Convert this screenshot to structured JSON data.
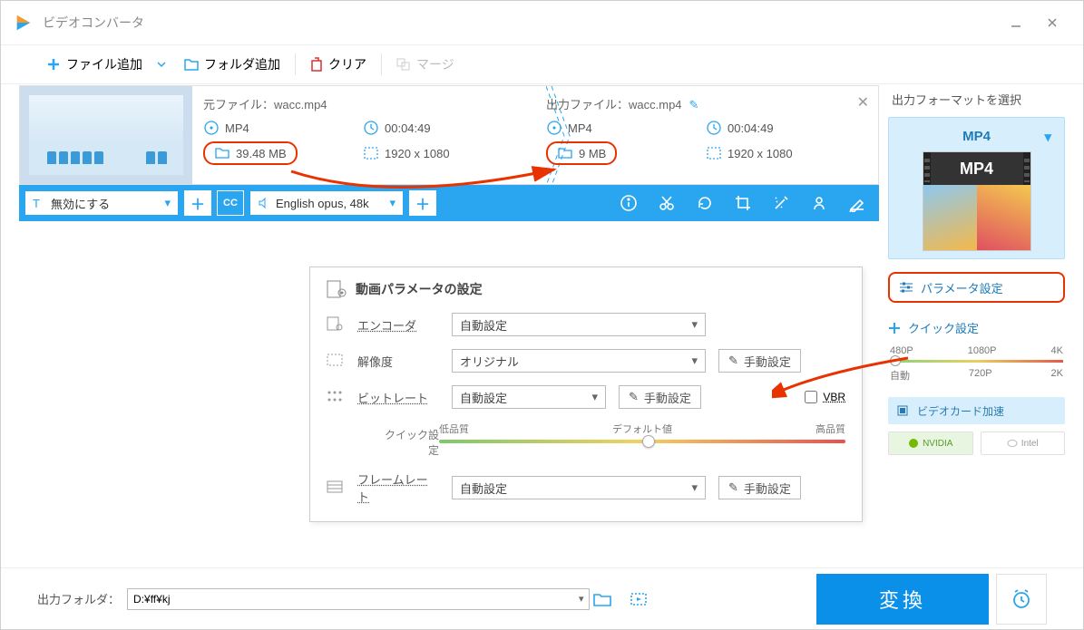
{
  "title": "ビデオコンバータ",
  "toolbar": {
    "add_file": "ファイル追加",
    "add_folder": "フォルダ追加",
    "clear": "クリア",
    "merge": "マージ"
  },
  "file": {
    "source": {
      "label": "元ファイル：",
      "name": "wacc.mp4",
      "format": "MP4",
      "duration": "00:04:49",
      "size": "39.48 MB",
      "resolution": "1920 x 1080"
    },
    "output": {
      "label": "出力ファイル：",
      "name": "wacc.mp4",
      "format": "MP4",
      "duration": "00:04:49",
      "size": "9 MB",
      "resolution": "1920 x 1080"
    }
  },
  "optbar": {
    "subtitle_mode": "無効にする",
    "audio_track": "English opus, 48k"
  },
  "params": {
    "panel_title": "動画パラメータの設定",
    "encoder_label": "エンコーダ",
    "encoder_value": "自動設定",
    "resolution_label": "解像度",
    "resolution_value": "オリジナル",
    "bitrate_label": "ビットレート",
    "bitrate_value": "自動設定",
    "vbr_label": "VBR",
    "quick_label": "クイック設定",
    "quality_low": "低品質",
    "quality_default": "デフォルト値",
    "quality_high": "高品質",
    "framerate_label": "フレームレート",
    "framerate_value": "自動設定",
    "manual_button": "手動設定"
  },
  "right": {
    "header": "出力フォーマットを選択",
    "format": "MP4",
    "format_badge": "MP4",
    "param_button": "パラメータ設定",
    "quick_header": "クイック設定",
    "res_labels_top": {
      "p480": "480P",
      "p1080": "1080P",
      "p4k": "4K"
    },
    "res_labels_bottom": {
      "auto": "自動",
      "p720": "720P",
      "p2k": "2K"
    },
    "gpu_button": "ビデオカード加速",
    "nvidia": "NVIDIA",
    "intel": "Intel"
  },
  "bottom": {
    "output_folder_label": "出力フォルダ：",
    "output_folder_path": "D:¥ff¥kj",
    "convert": "変換"
  }
}
